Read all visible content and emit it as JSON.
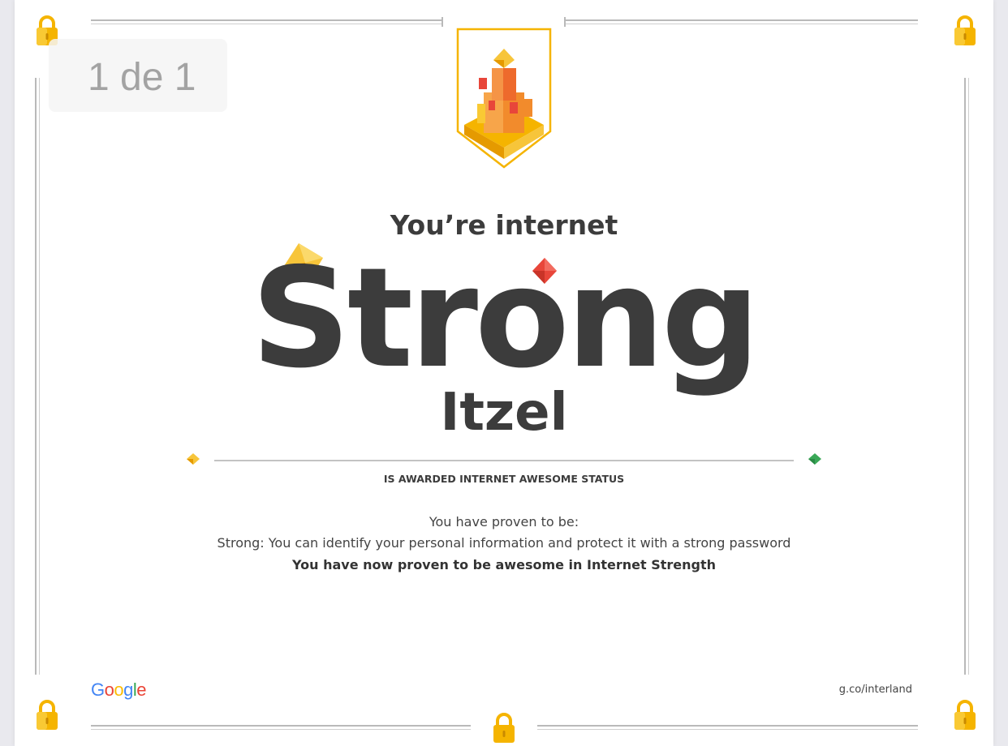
{
  "page_indicator": "1 de 1",
  "certificate": {
    "headline": "You’re internet",
    "title": "Strong",
    "recipient": "Itzel",
    "awarded_text": "IS AWARDED INTERNET AWESOME STATUS",
    "proven_intro": "You have proven to be:",
    "proven_detail": "Strong: You can identify your personal information and protect it with a strong password",
    "proven_summary": "You have now proven to be awesome in Internet Strength"
  },
  "footer": {
    "logo_text": [
      "G",
      "o",
      "o",
      "g",
      "l",
      "e"
    ],
    "url": "g.co/interland"
  },
  "colors": {
    "text_dark": "#3c3c3c",
    "lock_gold": "#f5b400",
    "gem_yellow": "#f7c53a",
    "gem_red": "#e8463a",
    "gem_green": "#3aa857",
    "google_blue": "#4285F4",
    "google_red": "#EA4335",
    "google_yellow": "#FBBC05",
    "google_green": "#34A853"
  },
  "icons": [
    "lock-icon",
    "castle-badge-icon",
    "gem-icon"
  ]
}
